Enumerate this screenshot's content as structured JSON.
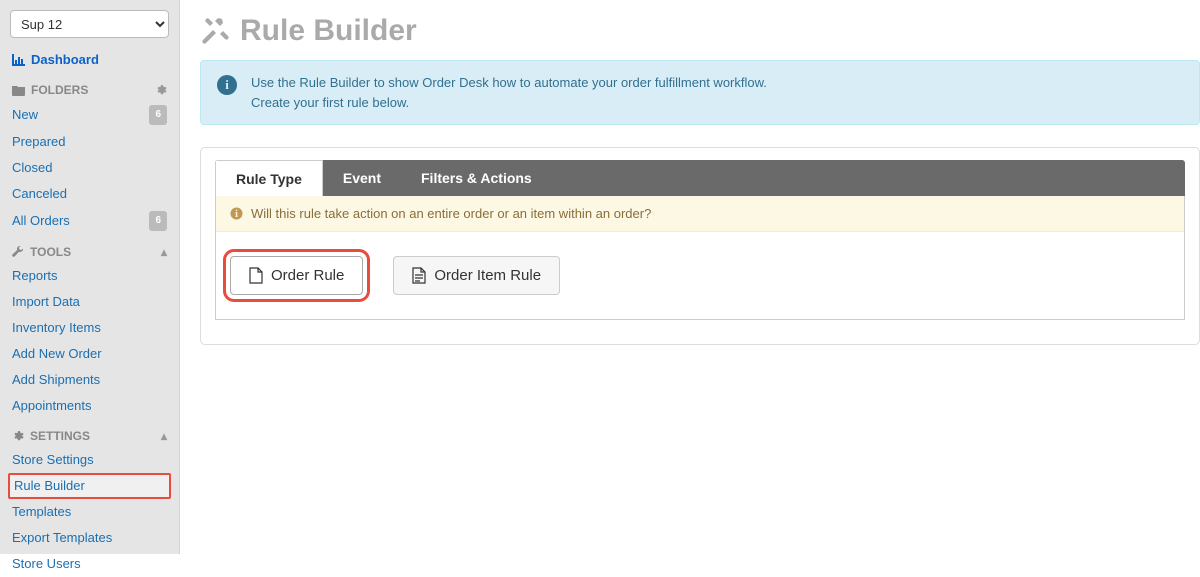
{
  "store_selector": {
    "value": "Sup 12"
  },
  "dashboard": {
    "label": "Dashboard"
  },
  "folders": {
    "header": "FOLDERS",
    "items": [
      {
        "label": "New",
        "badge": "6"
      },
      {
        "label": "Prepared",
        "badge": ""
      },
      {
        "label": "Closed",
        "badge": ""
      },
      {
        "label": "Canceled",
        "badge": ""
      },
      {
        "label": "All Orders",
        "badge": "6"
      }
    ]
  },
  "tools": {
    "header": "TOOLS",
    "items": [
      {
        "label": "Reports"
      },
      {
        "label": "Import Data"
      },
      {
        "label": "Inventory Items"
      },
      {
        "label": "Add New Order"
      },
      {
        "label": "Add Shipments"
      },
      {
        "label": "Appointments"
      }
    ]
  },
  "settings": {
    "header": "SETTINGS",
    "items": [
      {
        "label": "Store Settings"
      },
      {
        "label": "Rule Builder"
      },
      {
        "label": "Templates"
      },
      {
        "label": "Export Templates"
      },
      {
        "label": "Store Users"
      }
    ]
  },
  "page": {
    "title": "Rule Builder",
    "info_line1": "Use the Rule Builder to show Order Desk how to automate your order fulfillment workflow.",
    "info_line2": "Create your first rule below."
  },
  "tabs": {
    "rule_type": "Rule Type",
    "event": "Event",
    "filters_actions": "Filters & Actions"
  },
  "hint": "Will this rule take action on an entire order or an item within an order?",
  "buttons": {
    "order_rule": "Order Rule",
    "order_item_rule": "Order Item Rule"
  }
}
